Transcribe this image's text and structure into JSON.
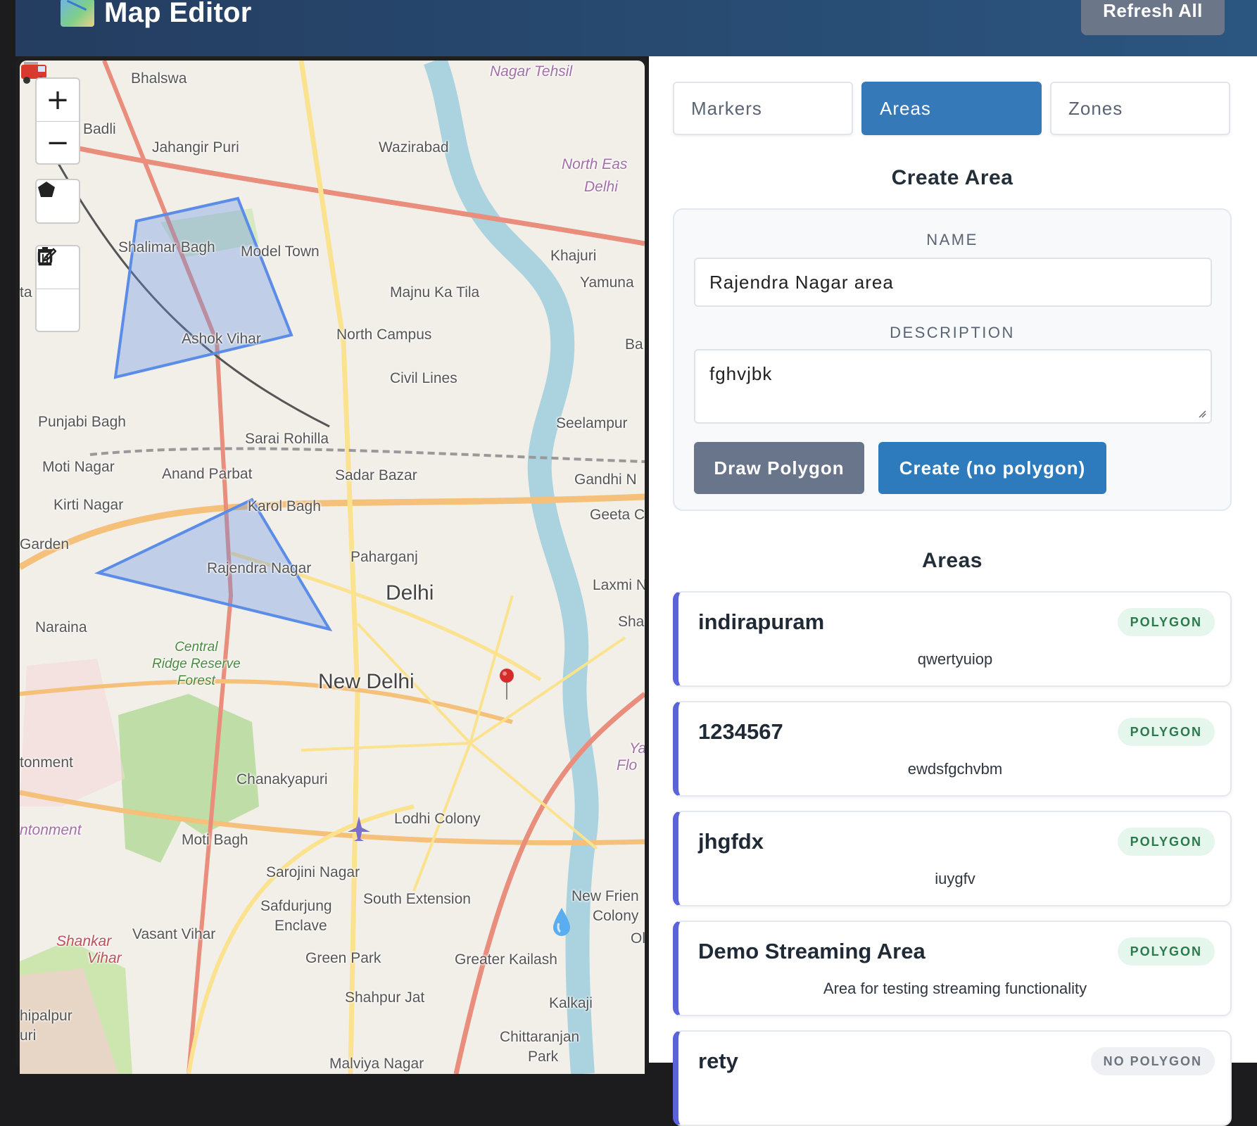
{
  "header": {
    "title": "Map Editor",
    "title_icon": "world-map-icon",
    "refresh_label": "Refresh All"
  },
  "map": {
    "zoom_in": "+",
    "zoom_out": "−",
    "places": {
      "bhalswa": "Bhalswa",
      "badli": "Badli",
      "jahangir_puri": "Jahangir Puri",
      "wazirabad": "Wazirabad",
      "nagar_tehsil": "Nagar Tehsil",
      "north_east_delhi_1": "North Eas",
      "north_east_delhi_2": "Delhi",
      "shalimar_bagh": "Shalimar Bagh",
      "model_town": "Model Town",
      "khajuri": "Khajuri",
      "yamuna": "Yamuna",
      "majnu_ka_tila": "Majnu Ka Tila",
      "ashok_vihar": "Ashok Vihar",
      "north_campus": "North Campus",
      "ba": "Ba",
      "ta": "ta",
      "civil_lines": "Civil Lines",
      "punjabi_bagh": "Punjabi Bagh",
      "seelampur": "Seelampur",
      "sarai_rohilla": "Sarai Rohilla",
      "moti_nagar": "Moti Nagar",
      "anand_parbat": "Anand Parbat",
      "sadar_bazar": "Sadar Bazar",
      "gandhi_nagar": "Gandhi N",
      "kirti_nagar": "Kirti Nagar",
      "karol_bagh": "Karol Bagh",
      "geeta": "Geeta C",
      "garden": "Garden",
      "paharganj": "Paharganj",
      "rajendra_nagar": "Rajendra Nagar",
      "delhi": "Delhi",
      "laxmi": "Laxmi N",
      "naraina": "Naraina",
      "sha": "Sha",
      "central_ridge": "Central\nRidge Reserve\nForest",
      "new_delhi": "New Delhi",
      "yamuna_flood_1": "Ya",
      "yamuna_flood_2": "Flo",
      "cantonment": "tonment",
      "chanakyapuri": "Chanakyapuri",
      "cantonment_admin": "ntonment",
      "lodhi_colony": "Lodhi Colony",
      "moti_bagh": "Moti Bagh",
      "sarojini_nagar": "Sarojini Nagar",
      "new_friends_1": "New Frien",
      "new_friends_2": "Colony",
      "safdurjung_1": "Safdurjung",
      "safdurjung_2": "Enclave",
      "south_extension": "South Extension",
      "vasant_vihar": "Vasant Vihar",
      "shankar_vihar_1": "Shankar",
      "shankar_vihar_2": "Vihar",
      "ok": "Ol",
      "green_park": "Green Park",
      "greater_kailash": "Greater Kailash",
      "shahpur_jat": "Shahpur Jat",
      "kalkaji": "Kalkaji",
      "mahipalpur": "hipalpur",
      "uri": "uri",
      "chittaranjan_1": "Chittaranjan",
      "chittaranjan_2": "Park",
      "malviya_nagar": "Malviya Nagar"
    }
  },
  "tabs": [
    {
      "label": "Markers",
      "active": false
    },
    {
      "label": "Areas",
      "active": true
    },
    {
      "label": "Zones",
      "active": false
    }
  ],
  "create_area": {
    "heading": "Create Area",
    "name_label": "NAME",
    "name_value": "Rajendra Nagar area",
    "description_label": "DESCRIPTION",
    "description_value": "fghvjbk",
    "draw_button": "Draw Polygon",
    "create_button": "Create (no polygon)"
  },
  "areas": {
    "heading": "Areas",
    "items": [
      {
        "name": "indirapuram",
        "description": "qwertyuiop",
        "badge": "POLYGON"
      },
      {
        "name": "1234567",
        "description": "ewdsfgchvbm",
        "badge": "POLYGON"
      },
      {
        "name": "jhgfdx",
        "description": "iuygfv",
        "badge": "POLYGON"
      },
      {
        "name": "Demo Streaming Area",
        "description": "Area for testing streaming functionality",
        "badge": "POLYGON"
      },
      {
        "name": "rety",
        "description": "",
        "badge": "NO POLYGON"
      }
    ]
  },
  "colors": {
    "header": "#2b5680",
    "accent": "#3579b9",
    "card_border_accent": "#5b63db",
    "polygon_fill": "#5b8de8",
    "badge_green_bg": "#e5f6ec"
  }
}
